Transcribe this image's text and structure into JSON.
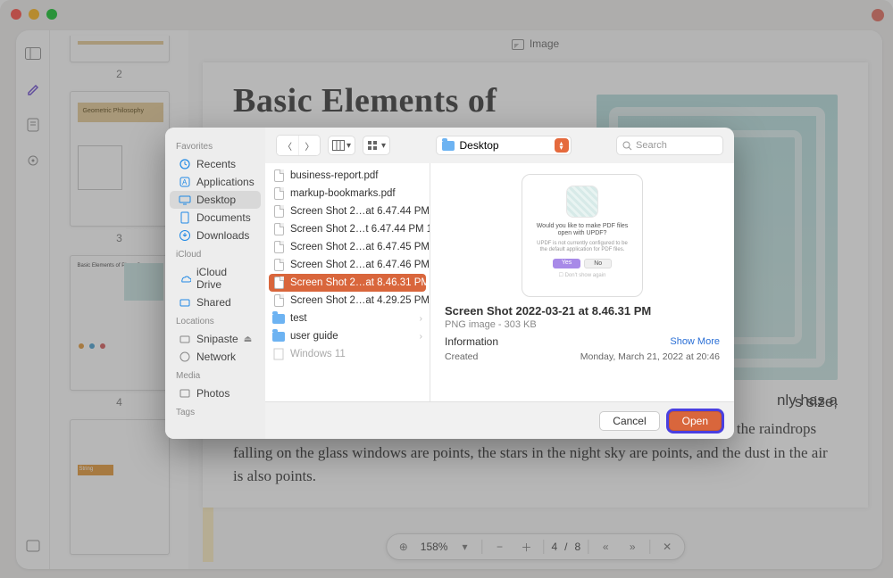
{
  "image_toolbar_label": "Image",
  "document": {
    "title": "Basic Elements of",
    "paragraph": "nly has a s size, shape, color, and texture. In nature, the sand and stones on the seashore are points, the raindrops falling on the glass windows are points, the stars in the night sky are points, and the dust in the air is also points."
  },
  "thumbs": {
    "page2": "2",
    "page3": "3",
    "page4": "4",
    "thumb3_title": "Geometric Philosophy",
    "thumb4_title": "Basic Elements of Plane Space",
    "thumb5_string": "String"
  },
  "zoom": {
    "pct": "158%",
    "current": "4",
    "sep": "/",
    "total": "8"
  },
  "panel": {
    "sidebar": {
      "favorites_h": "Favorites",
      "items_fav": [
        "Recents",
        "Applications",
        "Desktop",
        "Documents",
        "Downloads"
      ],
      "icloud_h": "iCloud",
      "items_icloud": [
        "iCloud Drive",
        "Shared"
      ],
      "locations_h": "Locations",
      "items_loc": [
        "Snipaste",
        "Network"
      ],
      "media_h": "Media",
      "items_media": [
        "Photos"
      ],
      "tags_h": "Tags"
    },
    "location": "Desktop",
    "search_ph": "Search",
    "files": [
      {
        "name": "business-report.pdf",
        "type": "doc"
      },
      {
        "name": "markup-bookmarks.pdf",
        "type": "doc"
      },
      {
        "name": "Screen Shot 2…at 6.47.44 PM",
        "type": "doc"
      },
      {
        "name": "Screen Shot 2…t 6.47.44 PM 1",
        "type": "doc"
      },
      {
        "name": "Screen Shot 2…at 6.47.45 PM",
        "type": "doc"
      },
      {
        "name": "Screen Shot 2…at 6.47.46 PM",
        "type": "doc"
      },
      {
        "name": "Screen Shot 2…at 8.46.31 PM",
        "type": "doc",
        "sel": true
      },
      {
        "name": "Screen Shot 2…at 4.29.25 PM",
        "type": "doc"
      },
      {
        "name": "test",
        "type": "folder",
        "chev": true
      },
      {
        "name": "user guide",
        "type": "folder",
        "chev": true
      },
      {
        "name": "Windows 11",
        "type": "dim"
      }
    ],
    "preview": {
      "q": "Would you like to make PDF files open with UPDF?",
      "sub": "UPDF is not currently configured to be the default application for PDF files.",
      "yes": "Yes",
      "no": "No",
      "dont": "Don't show again",
      "name": "Screen Shot 2022-03-21 at 8.46.31 PM",
      "meta": "PNG image - 303 KB",
      "info_h": "Information",
      "show_more": "Show More",
      "created_l": "Created",
      "created_v": "Monday, March 21, 2022 at 20:46"
    },
    "buttons": {
      "cancel": "Cancel",
      "open": "Open"
    }
  }
}
